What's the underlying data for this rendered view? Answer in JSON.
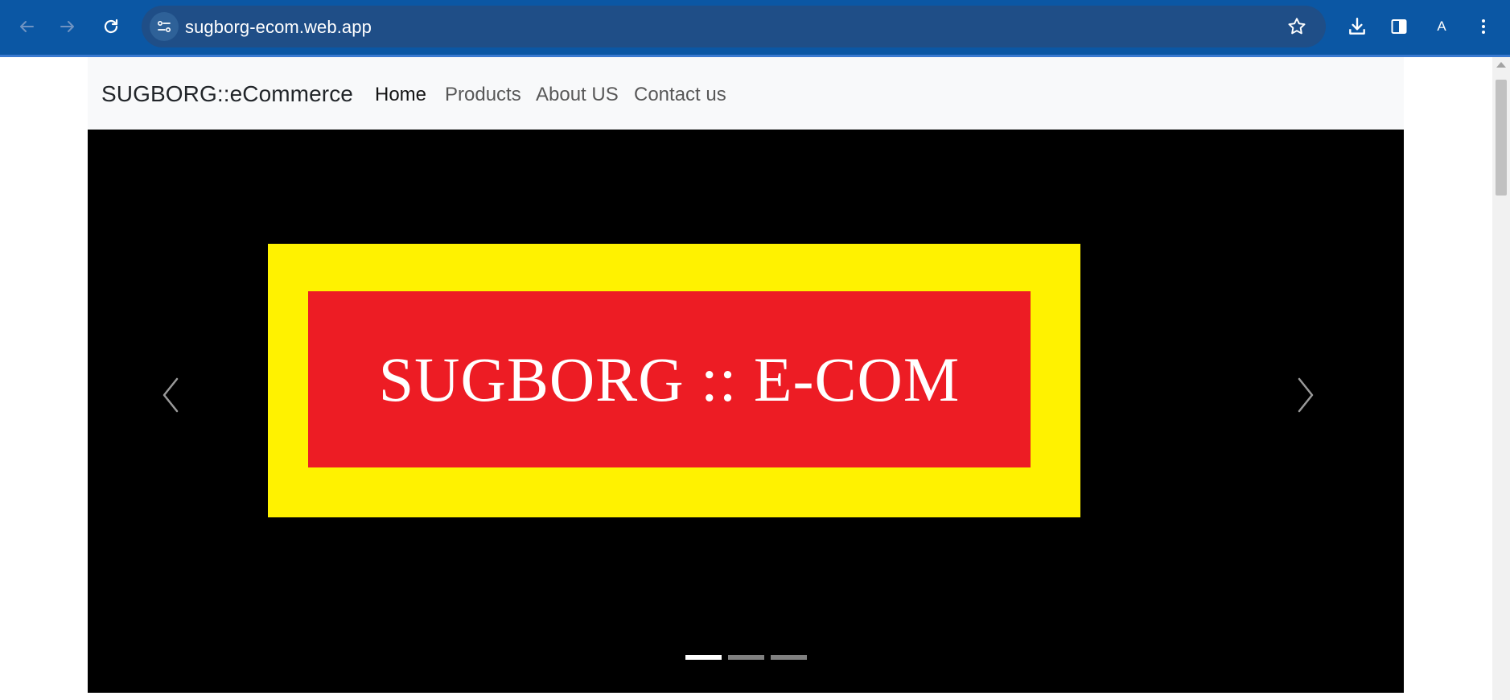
{
  "browser": {
    "url": "sugborg-ecom.web.app",
    "profile_initial": "A",
    "colors": {
      "toolbar": "#0b57a4",
      "omnibox": "#1f4e87"
    },
    "icons": [
      "back-icon",
      "forward-icon",
      "reload-icon",
      "site-info-icon",
      "bookmark-star-icon",
      "download-icon",
      "side-panel-icon",
      "more-menu-icon"
    ]
  },
  "navbar": {
    "brand": "SUGBORG::eCommerce",
    "links": [
      {
        "label": "Home",
        "active": true
      },
      {
        "label": "Products",
        "active": false
      },
      {
        "label": "About US",
        "active": false
      },
      {
        "label": "Contact us",
        "active": false
      }
    ]
  },
  "carousel": {
    "banner_text": "SUGBORG :: E-COM",
    "banner_colors": {
      "outer": "#fff200",
      "inner": "#ed1c24",
      "text": "#ffffff"
    },
    "slide_count": 3,
    "active_index": 0,
    "controls": {
      "prev_icon": "chevron-left-icon",
      "next_icon": "chevron-right-icon"
    }
  }
}
